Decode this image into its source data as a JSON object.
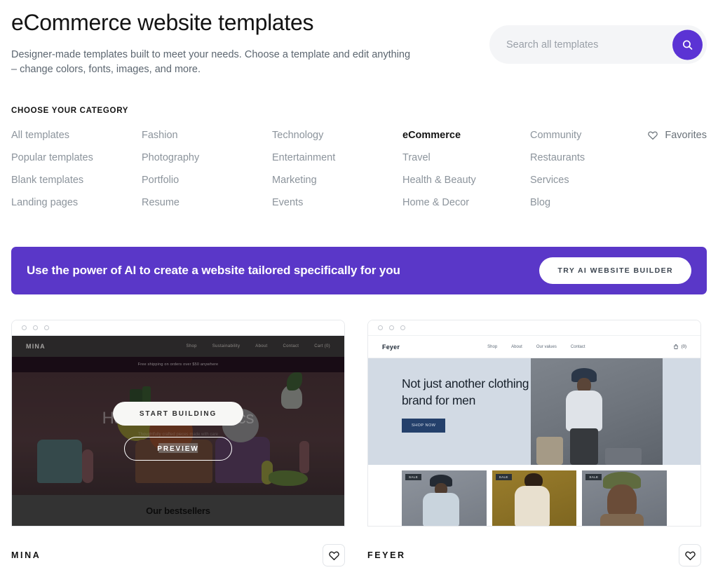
{
  "header": {
    "title": "eCommerce website templates",
    "subtitle": "Designer-made templates built to meet your needs. Choose a template and edit anything – change colors, fonts, images, and more."
  },
  "search": {
    "placeholder": "Search all templates",
    "value": "",
    "icon": "search-icon",
    "button_color": "#5b33d4"
  },
  "categories": {
    "heading": "CHOOSE YOUR CATEGORY",
    "items": [
      {
        "label": "All templates",
        "active": false
      },
      {
        "label": "Fashion",
        "active": false
      },
      {
        "label": "Technology",
        "active": false
      },
      {
        "label": "eCommerce",
        "active": true
      },
      {
        "label": "Community",
        "active": false
      },
      {
        "label": "Popular templates",
        "active": false
      },
      {
        "label": "Photography",
        "active": false
      },
      {
        "label": "Entertainment",
        "active": false
      },
      {
        "label": "Travel",
        "active": false
      },
      {
        "label": "Restaurants",
        "active": false
      },
      {
        "label": "Blank templates",
        "active": false
      },
      {
        "label": "Portfolio",
        "active": false
      },
      {
        "label": "Marketing",
        "active": false
      },
      {
        "label": "Health & Beauty",
        "active": false
      },
      {
        "label": "Services",
        "active": false
      },
      {
        "label": "Landing pages",
        "active": false
      },
      {
        "label": "Resume",
        "active": false
      },
      {
        "label": "Events",
        "active": false
      },
      {
        "label": "Home & Decor",
        "active": false
      },
      {
        "label": "Blog",
        "active": false
      }
    ],
    "favorites": {
      "label": "Favorites",
      "icon": "heart-icon"
    }
  },
  "ai_banner": {
    "text": "Use the power of AI to create a website tailored specifically for you",
    "button_label": "TRY AI WEBSITE BUILDER",
    "background": "#5a37c8"
  },
  "templates": [
    {
      "name": "MINA",
      "favorite_icon": "heart-icon",
      "overlay": {
        "primary": "START BUILDING",
        "secondary": "PREVIEW"
      },
      "preview": {
        "logo": "MINA",
        "nav": [
          "Shop",
          "Sustainability",
          "About",
          "Contact"
        ],
        "cart": "Cart (0)",
        "announcement": "Free shipping on orders over $50 anywhere",
        "hero_title": "Handmade ceramics",
        "hero_sub": "Thoughtfully crafted pieces made with care",
        "hero_cta": "Shop now",
        "section_title": "Our bestsellers"
      }
    },
    {
      "name": "FEYER",
      "favorite_icon": "heart-icon",
      "overlay": {
        "primary": "START BUILDING",
        "secondary": "PREVIEW"
      },
      "preview": {
        "logo": "Feyer",
        "nav": [
          "Shop",
          "About",
          "Our values",
          "Contact"
        ],
        "cart": "(0)",
        "hero_title": "Not just another clothing brand for men",
        "hero_cta": "SHOP NOW",
        "product_badges": [
          "SALE",
          "SALE",
          "SALE"
        ]
      }
    }
  ]
}
